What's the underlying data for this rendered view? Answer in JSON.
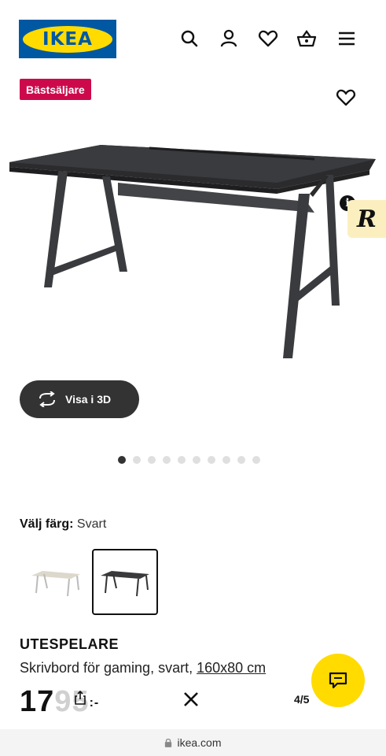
{
  "header": {
    "logo_text": "IKEA",
    "icons": [
      "search-icon",
      "user-icon",
      "heart-icon",
      "basket-icon",
      "menu-icon"
    ]
  },
  "product": {
    "badge": "Bästsäljare",
    "view_3d_label": "Visa i 3D",
    "image_count": 10,
    "active_image": 1,
    "color_label": "Välj färg:",
    "color_value": "Svart",
    "colors": [
      {
        "name": "white",
        "selected": false
      },
      {
        "name": "black",
        "selected": true
      }
    ],
    "name": "UTESPELARE",
    "description": "Skrivbord för gaming, svart, ",
    "dimensions": "160x80 cm",
    "price_visible": "17",
    "price_faded": "95",
    "price_suffix": ":-"
  },
  "overlay": {
    "close_symbol": "✕",
    "page_indicator": "4/5"
  },
  "browser": {
    "url": "ikea.com"
  },
  "colors": {
    "ikea_blue": "#0058a3",
    "ikea_yellow": "#ffdb00",
    "badge_red": "#cc0a4b"
  }
}
